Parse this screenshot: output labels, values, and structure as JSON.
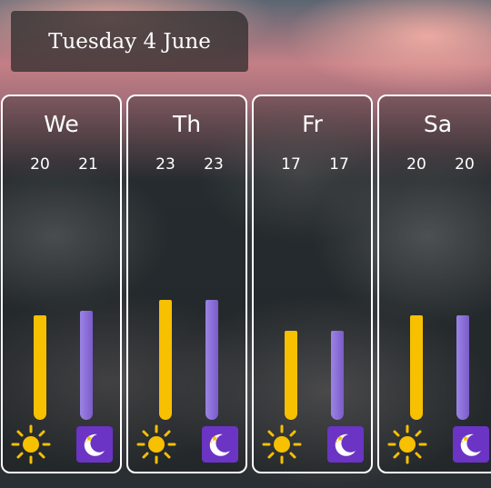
{
  "header": {
    "date": "Tuesday 4 June"
  },
  "colors": {
    "day_bar": "#f7c000",
    "night_bar": "#8a6fd6",
    "sun": "#f7c000",
    "moon_bg": "#6b34c4",
    "card_border": "#ffffff"
  },
  "days": [
    {
      "label": "We",
      "day_temp": "20",
      "night_temp": "21",
      "day_icon": "sun-icon",
      "night_icon": "moon-icon"
    },
    {
      "label": "Th",
      "day_temp": "23",
      "night_temp": "23",
      "day_icon": "sun-icon",
      "night_icon": "moon-icon"
    },
    {
      "label": "Fr",
      "day_temp": "17",
      "night_temp": "17",
      "day_icon": "sun-icon",
      "night_icon": "moon-icon"
    },
    {
      "label": "Sa",
      "day_temp": "20",
      "night_temp": "20",
      "day_icon": "sun-icon",
      "night_icon": "moon-icon"
    }
  ]
}
